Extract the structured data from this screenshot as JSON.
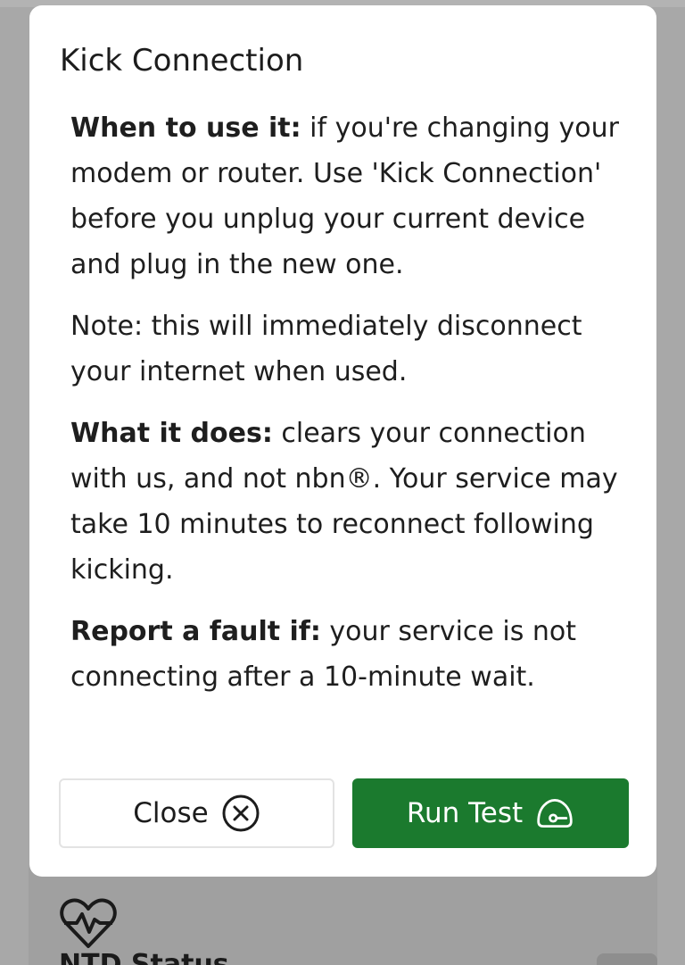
{
  "dialog": {
    "title": "Kick Connection",
    "paragraphs": {
      "p1_bold": "When to use it:",
      "p1_text": " if you're changing your modem or router. Use 'Kick Connection' before you unplug your current device and plug in the new one.",
      "p2_text": "Note: this will immediately disconnect your internet when used.",
      "p3_bold": "What it does:",
      "p3_text": " clears your connection with us, and not nbn®. Your service may take 10 minutes to reconnect following kicking.",
      "p4_bold": "Report a fault if:",
      "p4_text": " your service is not connecting after a 10-minute wait."
    },
    "buttons": {
      "close_label": "Close",
      "close_icon": "close-circle-icon",
      "run_label": "Run Test",
      "run_icon": "speedometer-icon"
    }
  },
  "background": {
    "ntd_label": "NTD Status",
    "ntd_icon": "heart-pulse-icon"
  },
  "colors": {
    "primary_green": "#1b7a2e",
    "overlay": "#a8a8a8",
    "dialog_bg": "#ffffff"
  }
}
